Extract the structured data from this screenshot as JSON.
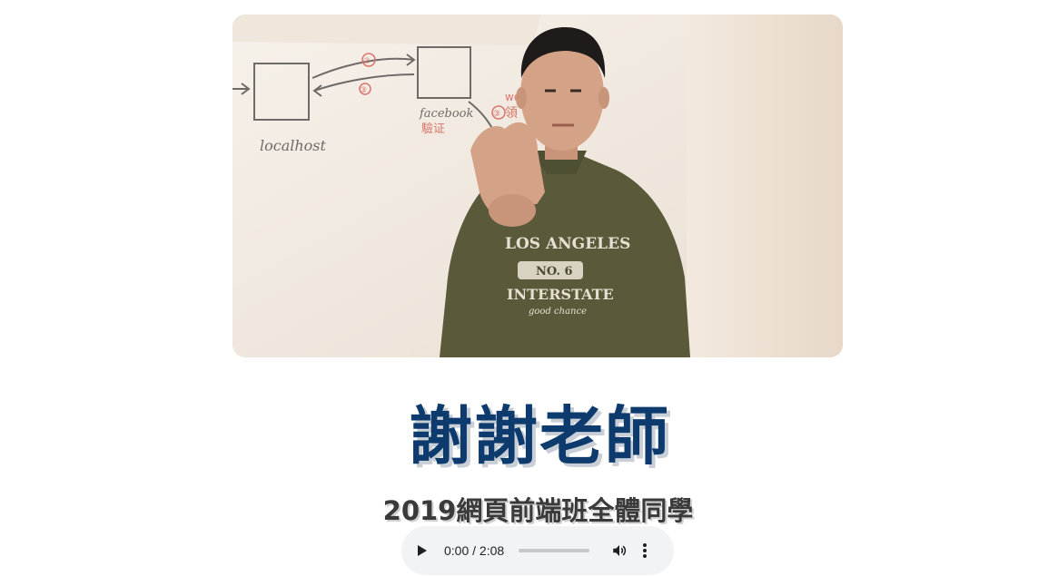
{
  "photo": {
    "whiteboard_labels": {
      "left_box": "localhost",
      "right_box": "facebook",
      "right_box_note": "驗证",
      "step_a": "②",
      "step_b": "③",
      "step_c": "③",
      "step_c_text": "領",
      "side_note": "wo"
    },
    "sweater_text": {
      "top": "LOS ANGELES",
      "badge": "NO. 6",
      "middle": "INTERSTATE",
      "bottom": "good chance"
    }
  },
  "title": "謝謝老師",
  "subtitle": "2019網頁前端班全體同學",
  "audio": {
    "time_display": "0:00 / 2:08",
    "progress": 0
  },
  "colors": {
    "title": "#0e3b6e",
    "subtitle": "#3a3a3a",
    "audio_bg": "#f1f3f4"
  }
}
